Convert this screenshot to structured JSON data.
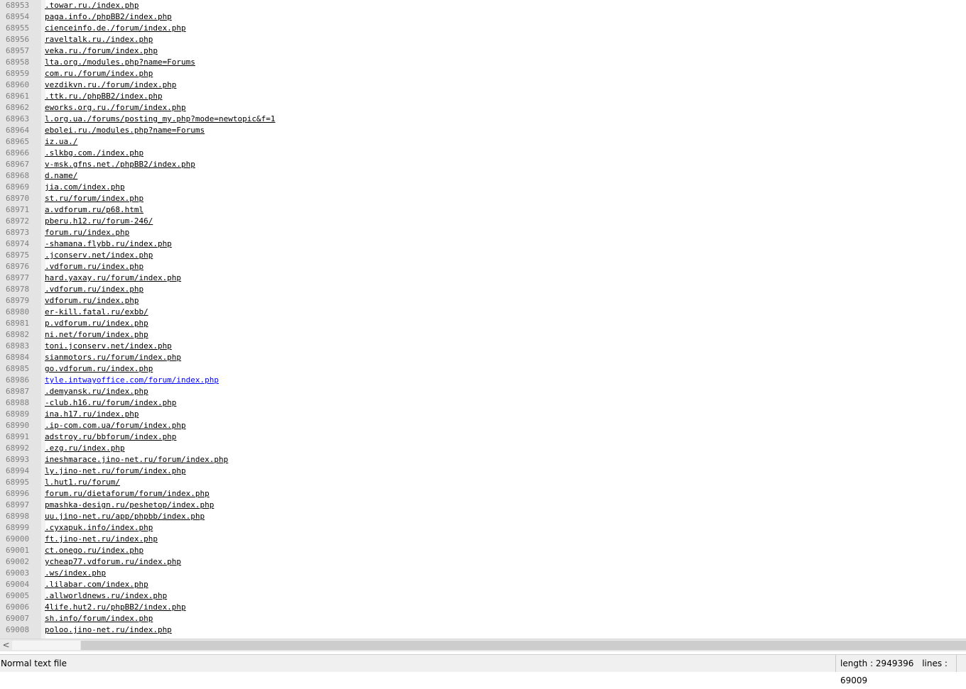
{
  "editor": {
    "lines": [
      {
        "number": "68953",
        "text": ".towar.ru./index.php",
        "link": false
      },
      {
        "number": "68954",
        "text": "paga.info./phpBB2/index.php",
        "link": false
      },
      {
        "number": "68955",
        "text": "cienceinfo.de./forum/index.php",
        "link": false
      },
      {
        "number": "68956",
        "text": "raveltalk.ru./index.php",
        "link": false
      },
      {
        "number": "68957",
        "text": "veka.ru./forum/index.php",
        "link": false
      },
      {
        "number": "68958",
        "text": "lta.org./modules.php?name=Forums",
        "link": false
      },
      {
        "number": "68959",
        "text": "com.ru./forum/index.php",
        "link": false
      },
      {
        "number": "68960",
        "text": "vezdikvn.ru./forum/index.php",
        "link": false
      },
      {
        "number": "68961",
        "text": ".ttk.ru./phpBB2/index.php",
        "link": false
      },
      {
        "number": "68962",
        "text": "eworks.org.ru./forum/index.php",
        "link": false
      },
      {
        "number": "68963",
        "text": "l.org.ua./forums/posting_my.php?mode=newtopic&f=1",
        "link": false
      },
      {
        "number": "68964",
        "text": "ebolei.ru./modules.php?name=Forums",
        "link": false
      },
      {
        "number": "68965",
        "text": "iz.ua./",
        "link": false
      },
      {
        "number": "68966",
        "text": ".slkbg.com./index.php",
        "link": false
      },
      {
        "number": "68967",
        "text": "v-msk.gfns.net./phpBB2/index.php",
        "link": false
      },
      {
        "number": "68968",
        "text": "d.name/",
        "link": false
      },
      {
        "number": "68969",
        "text": "jia.com/index.php",
        "link": false
      },
      {
        "number": "68970",
        "text": "st.ru/forum/index.php",
        "link": false
      },
      {
        "number": "68971",
        "text": "a.vdforum.ru/p68.html",
        "link": false
      },
      {
        "number": "68972",
        "text": "pberu.h12.ru/forum-246/",
        "link": false
      },
      {
        "number": "68973",
        "text": "forum.ru/index.php",
        "link": false
      },
      {
        "number": "68974",
        "text": "-shamana.flybb.ru/index.php",
        "link": false
      },
      {
        "number": "68975",
        "text": ".jconserv.net/index.php",
        "link": false
      },
      {
        "number": "68976",
        "text": ".vdforum.ru/index.php",
        "link": false
      },
      {
        "number": "68977",
        "text": "hard.yaxay.ru/forum/index.php",
        "link": false
      },
      {
        "number": "68978",
        "text": ".vdforum.ru/index.php",
        "link": false
      },
      {
        "number": "68979",
        "text": "vdforum.ru/index.php",
        "link": false
      },
      {
        "number": "68980",
        "text": "er-kill.fatal.ru/exbb/",
        "link": false
      },
      {
        "number": "68981",
        "text": "p.vdforum.ru/index.php",
        "link": false
      },
      {
        "number": "68982",
        "text": "ni.net/forum/index.php",
        "link": false
      },
      {
        "number": "68983",
        "text": "toni.jconserv.net/index.php",
        "link": false
      },
      {
        "number": "68984",
        "text": "sianmotors.ru/forum/index.php",
        "link": false
      },
      {
        "number": "68985",
        "text": "go.vdforum.ru/index.php",
        "link": false
      },
      {
        "number": "68986",
        "text": "tyle.intwayoffice.com/forum/index.php",
        "link": true
      },
      {
        "number": "68987",
        "text": ".demyansk.ru/index.php",
        "link": false
      },
      {
        "number": "68988",
        "text": "-club.h16.ru/forum/index.php",
        "link": false
      },
      {
        "number": "68989",
        "text": "ina.h17.ru/index.php",
        "link": false
      },
      {
        "number": "68990",
        "text": ".ip-com.com.ua/forum/index.php",
        "link": false
      },
      {
        "number": "68991",
        "text": "adstroy.ru/bbforum/index.php",
        "link": false
      },
      {
        "number": "68992",
        "text": ".ezg.ru/index.php",
        "link": false
      },
      {
        "number": "68993",
        "text": "ineshmarace.jino-net.ru/forum/index.php",
        "link": false
      },
      {
        "number": "68994",
        "text": "ly.jino-net.ru/forum/index.php",
        "link": false
      },
      {
        "number": "68995",
        "text": "l.hut1.ru/forum/",
        "link": false
      },
      {
        "number": "68996",
        "text": "forum.ru/dietaforum/forum/index.php",
        "link": false
      },
      {
        "number": "68997",
        "text": "pmashka-design.ru/peshetop/index.php",
        "link": false
      },
      {
        "number": "68998",
        "text": "uu.jino-net.ru/app/phpbb/index.php",
        "link": false
      },
      {
        "number": "68999",
        "text": ".cyxapuk.info/index.php",
        "link": false
      },
      {
        "number": "69000",
        "text": "ft.jino-net.ru/index.php",
        "link": false
      },
      {
        "number": "69001",
        "text": "ct.onego.ru/index.php",
        "link": false
      },
      {
        "number": "69002",
        "text": "ycheap77.vdforum.ru/index.php",
        "link": false
      },
      {
        "number": "69003",
        "text": ".ws/index.php",
        "link": false
      },
      {
        "number": "69004",
        "text": ".lilabar.com/index.php",
        "link": false
      },
      {
        "number": "69005",
        "text": ".allworldnews.ru/index.php",
        "link": false
      },
      {
        "number": "69006",
        "text": "4life.hut2.ru/phpBB2/index.php",
        "link": false
      },
      {
        "number": "69007",
        "text": "sh.info/forum/index.php",
        "link": false
      },
      {
        "number": "69008",
        "text": "poloo.jino-net.ru/index.php",
        "link": false
      }
    ]
  },
  "scrollbar": {
    "left_arrow": "<"
  },
  "statusbar": {
    "file_type": "Normal text file",
    "length": "length : 2949396",
    "lines": "lines : 69009"
  },
  "colors": {
    "link": "#0000ff",
    "text": "#000000",
    "line_number": "#808080"
  }
}
